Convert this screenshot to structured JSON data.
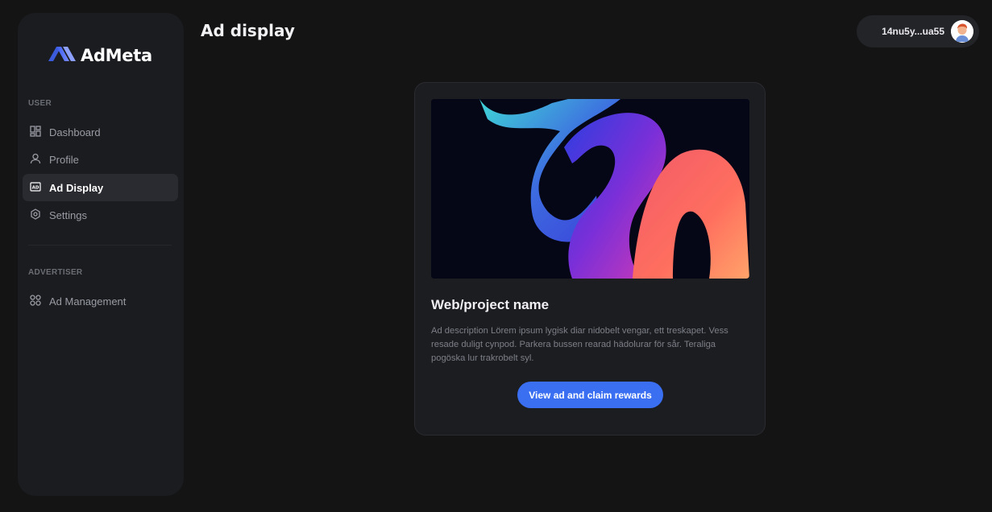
{
  "app": {
    "logo_text": "AdMeta",
    "page_title": "Ad display",
    "brand_color": "#3a6ff2"
  },
  "account": {
    "address": "14nu5y...ua55",
    "avatar_icon": "user-avatar"
  },
  "sidebar": {
    "sections": [
      {
        "label": "USER",
        "items": [
          {
            "label": "Dashboard",
            "icon": "dashboard-icon",
            "active": false
          },
          {
            "label": "Profile",
            "icon": "user-icon",
            "active": false
          },
          {
            "label": "Ad Display",
            "icon": "ad-icon",
            "active": true
          },
          {
            "label": "Settings",
            "icon": "gear-icon",
            "active": false
          }
        ]
      },
      {
        "label": "ADVERTISER",
        "items": [
          {
            "label": "Ad Management",
            "icon": "apps-icon",
            "active": false
          }
        ]
      }
    ]
  },
  "ad_card": {
    "title": "Web/project name",
    "description": "Ad description Lörem ipsum lygisk diar nidobelt vengar, ett treskapet. Vess resade duligt cynpod. Parkera bussen rearad hädolurar för sår. Teraliga pogöska lur trakrobelt syl.",
    "cta_label": "View ad and claim rewards"
  }
}
